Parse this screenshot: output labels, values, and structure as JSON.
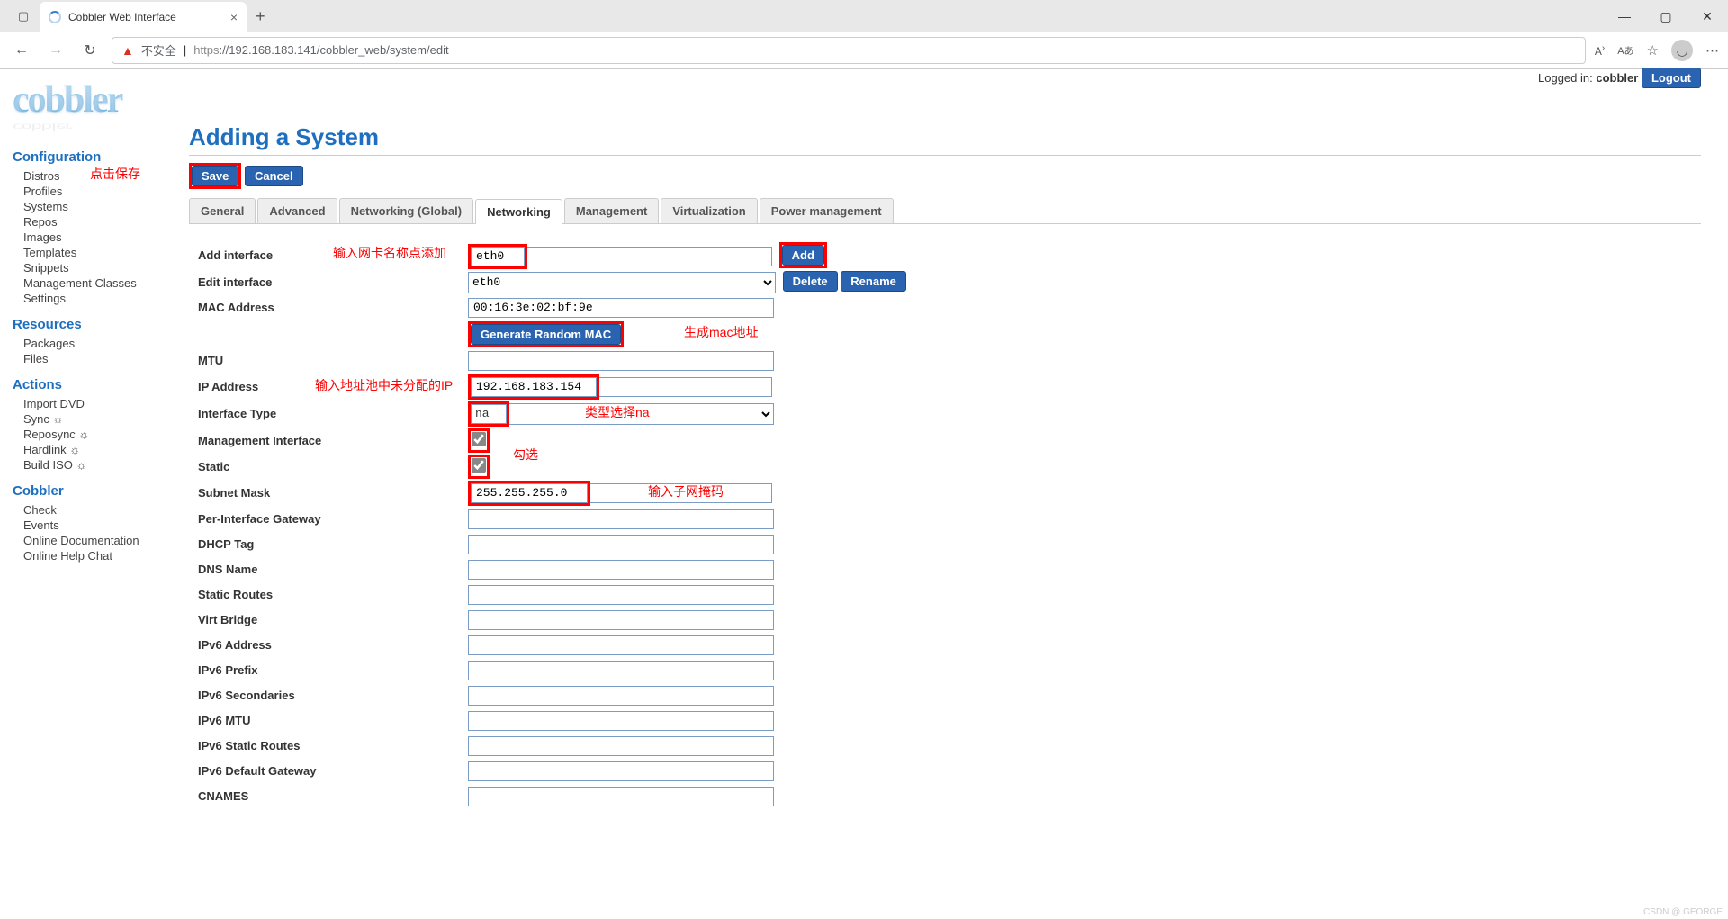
{
  "browser": {
    "tab_title": "Cobbler Web Interface",
    "insecure_label": "不安全",
    "url_scheme": "https",
    "url_rest": "://192.168.183.141/cobbler_web/system/edit",
    "lang_badge": "Aあ"
  },
  "header": {
    "logged_in_label": "Logged in:",
    "username": "cobbler",
    "logout_btn": "Logout"
  },
  "sidebar": {
    "s0_title": "Configuration",
    "s0_items": [
      "Distros",
      "Profiles",
      "Systems",
      "Repos",
      "Images",
      "Templates",
      "Snippets",
      "Management Classes",
      "Settings"
    ],
    "s1_title": "Resources",
    "s1_items": [
      "Packages",
      "Files"
    ],
    "s2_title": "Actions",
    "s2_items": [
      "Import DVD",
      "Sync ☼",
      "Reposync ☼",
      "Hardlink ☼",
      "Build ISO ☼"
    ],
    "s3_title": "Cobbler",
    "s3_items": [
      "Check",
      "Events",
      "Online Documentation",
      "Online Help Chat"
    ]
  },
  "page_title": "Adding a System",
  "buttons": {
    "save": "Save",
    "cancel": "Cancel",
    "add": "Add",
    "delete": "Delete",
    "rename": "Rename",
    "gen_mac": "Generate Random MAC"
  },
  "tabs": [
    "General",
    "Advanced",
    "Networking (Global)",
    "Networking",
    "Management",
    "Virtualization",
    "Power management"
  ],
  "active_tab_index": 3,
  "form": {
    "add_interface_label": "Add interface",
    "add_interface_value": "eth0",
    "edit_interface_label": "Edit interface",
    "edit_interface_value": "eth0",
    "mac_label": "MAC Address",
    "mac_value": "00:16:3e:02:bf:9e",
    "mtu_label": "MTU",
    "mtu_value": "",
    "ip_label": "IP Address",
    "ip_value": "192.168.183.154",
    "iftype_label": "Interface Type",
    "iftype_value": "na",
    "mgmt_label": "Management Interface",
    "static_label": "Static",
    "subnet_label": "Subnet Mask",
    "subnet_value": "255.255.255.0",
    "pergw_label": "Per-Interface Gateway",
    "pergw_value": "",
    "dhcp_label": "DHCP Tag",
    "dhcp_value": "",
    "dns_label": "DNS Name",
    "dns_value": "",
    "sroutes_label": "Static Routes",
    "sroutes_value": "",
    "vbridge_label": "Virt Bridge",
    "vbridge_value": "",
    "ip6a_label": "IPv6 Address",
    "ip6a_value": "",
    "ip6p_label": "IPv6 Prefix",
    "ip6p_value": "",
    "ip6s_label": "IPv6 Secondaries",
    "ip6s_value": "",
    "ip6m_label": "IPv6 MTU",
    "ip6m_value": "",
    "ip6r_label": "IPv6 Static Routes",
    "ip6r_value": "",
    "ip6g_label": "IPv6 Default Gateway",
    "ip6g_value": "",
    "cnames_label": "CNAMES",
    "cnames_value": ""
  },
  "annotations": {
    "save": "点击保存",
    "add_iface": "输入网卡名称点添加",
    "gen_mac": "生成mac地址",
    "ip": "输入地址池中未分配的IP",
    "iftype": "类型选择na",
    "check": "勾选",
    "subnet": "输入子网掩码"
  },
  "watermark": "CSDN @.GEORGE"
}
